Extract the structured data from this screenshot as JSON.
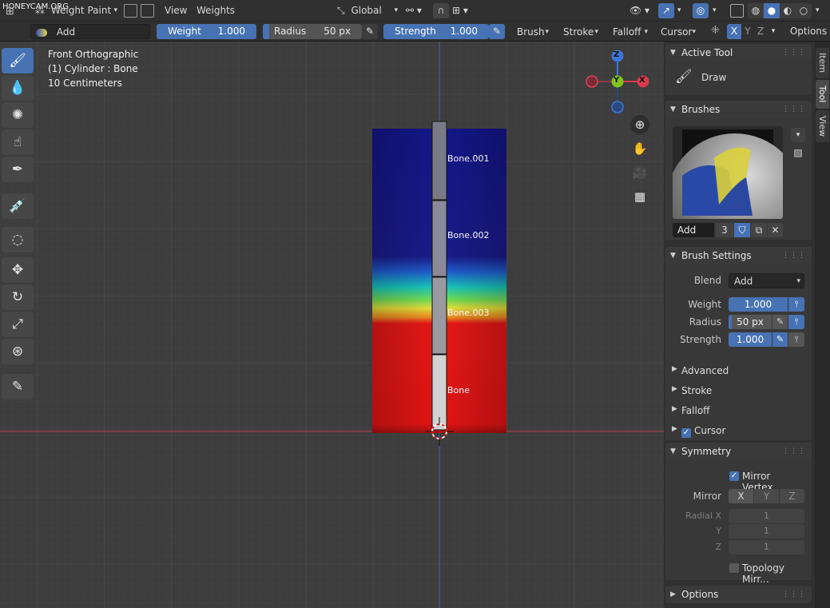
{
  "watermark": "HONEYCAM.ORG",
  "header": {
    "mode_label": "Weight Paint",
    "menu_view": "View",
    "menu_weights": "Weights",
    "orientation_label": "Global"
  },
  "tool_header": {
    "blend_label": "Add",
    "weight": {
      "label": "Weight",
      "value": "1.000"
    },
    "radius": {
      "label": "Radius",
      "value": "50 px"
    },
    "strength": {
      "label": "Strength",
      "value": "1.000"
    },
    "brush_menu": "Brush",
    "stroke_menu": "Stroke",
    "falloff_menu": "Falloff",
    "cursor_menu": "Cursor",
    "axis_x": "X",
    "axis_y": "Y",
    "axis_z": "Z",
    "options_label": "Options"
  },
  "viewport": {
    "view_name": "Front Orthographic",
    "object_info": "(1) Cylinder : Bone",
    "scale_info": "10 Centimeters",
    "gizmo": {
      "z": "Z",
      "y": "Y",
      "x": "X"
    },
    "bones": [
      "Bone.001",
      "Bone.002",
      "Bone.003",
      "Bone"
    ]
  },
  "sidebar": {
    "tabs": [
      "Item",
      "Tool",
      "View"
    ],
    "active_tool": {
      "title": "Active Tool",
      "tool_name": "Draw"
    },
    "brushes": {
      "title": "Brushes",
      "brush_name": "Add",
      "user_count": "3"
    },
    "brush_settings": {
      "title": "Brush Settings",
      "blend_label": "Blend",
      "blend_value": "Add",
      "weight_label": "Weight",
      "weight_value": "1.000",
      "radius_label": "Radius",
      "radius_value": "50 px",
      "strength_label": "Strength",
      "strength_value": "1.000",
      "subpanels": [
        "Advanced",
        "Stroke",
        "Falloff",
        "Cursor"
      ]
    },
    "symmetry": {
      "title": "Symmetry",
      "mirror_vertex_label": "Mirror Vertex...",
      "mirror_label": "Mirror",
      "axes": [
        "X",
        "Y",
        "Z"
      ],
      "radial_x_label": "Radial X",
      "radial_y_label": "Y",
      "radial_z_label": "Z",
      "radial_values": [
        "1",
        "1",
        "1"
      ],
      "topology_label": "Topology Mirr..."
    },
    "options": {
      "title": "Options"
    }
  },
  "colors": {
    "accent": "#4772b3",
    "mesh_blue": "#131a8e",
    "mesh_red": "#e81515"
  }
}
